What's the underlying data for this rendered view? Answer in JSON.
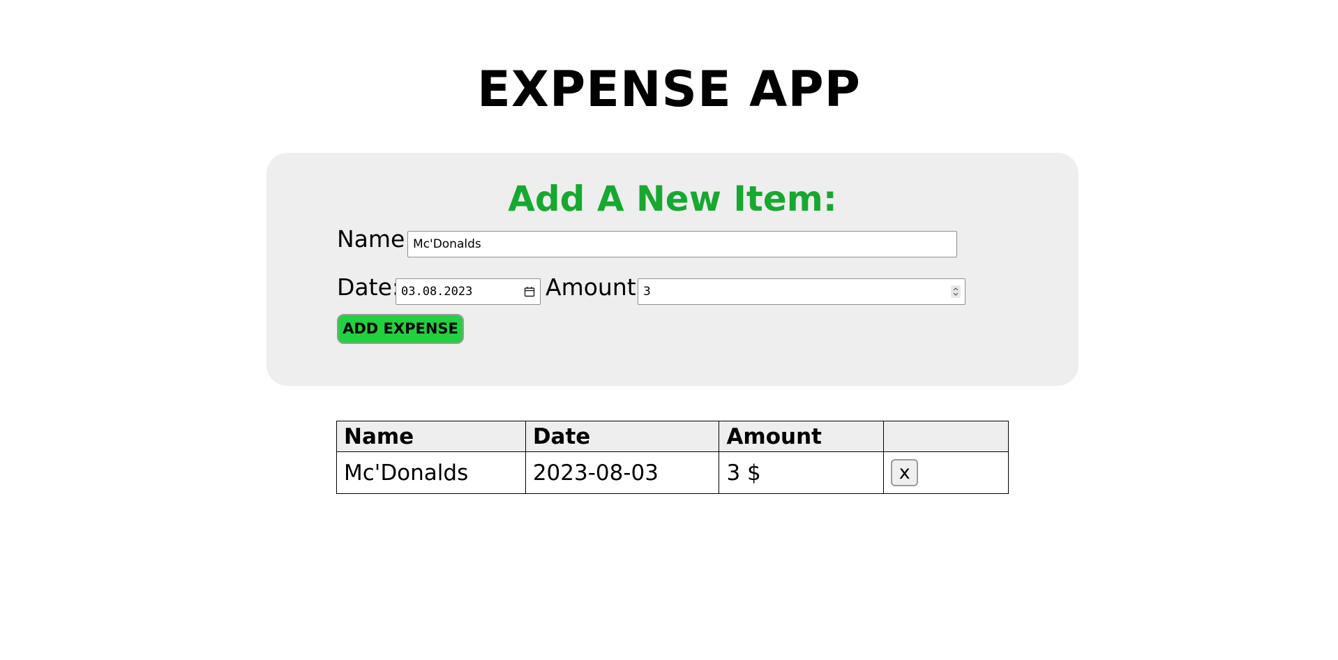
{
  "app": {
    "title": "EXPENSE APP"
  },
  "form": {
    "heading": "Add A New Item:",
    "name_label": "Name:",
    "name_value": "Mc'Donalds",
    "date_label": "Date:",
    "date_value": "03.08.2023",
    "amount_label": "Amount:",
    "amount_value": "3",
    "submit_label": "ADD EXPENSE",
    "heading_color": "#17a82f",
    "button_color": "#22d140"
  },
  "table": {
    "headers": [
      "Name",
      "Date",
      "Amount",
      ""
    ],
    "rows": [
      {
        "name": "Mc'Donalds",
        "date": "2023-08-03",
        "amount": "3 $",
        "delete_label": "x"
      }
    ]
  },
  "icons": {
    "date_picker": "calendar-icon",
    "amount_spinner": "spinner-arrows-icon"
  }
}
